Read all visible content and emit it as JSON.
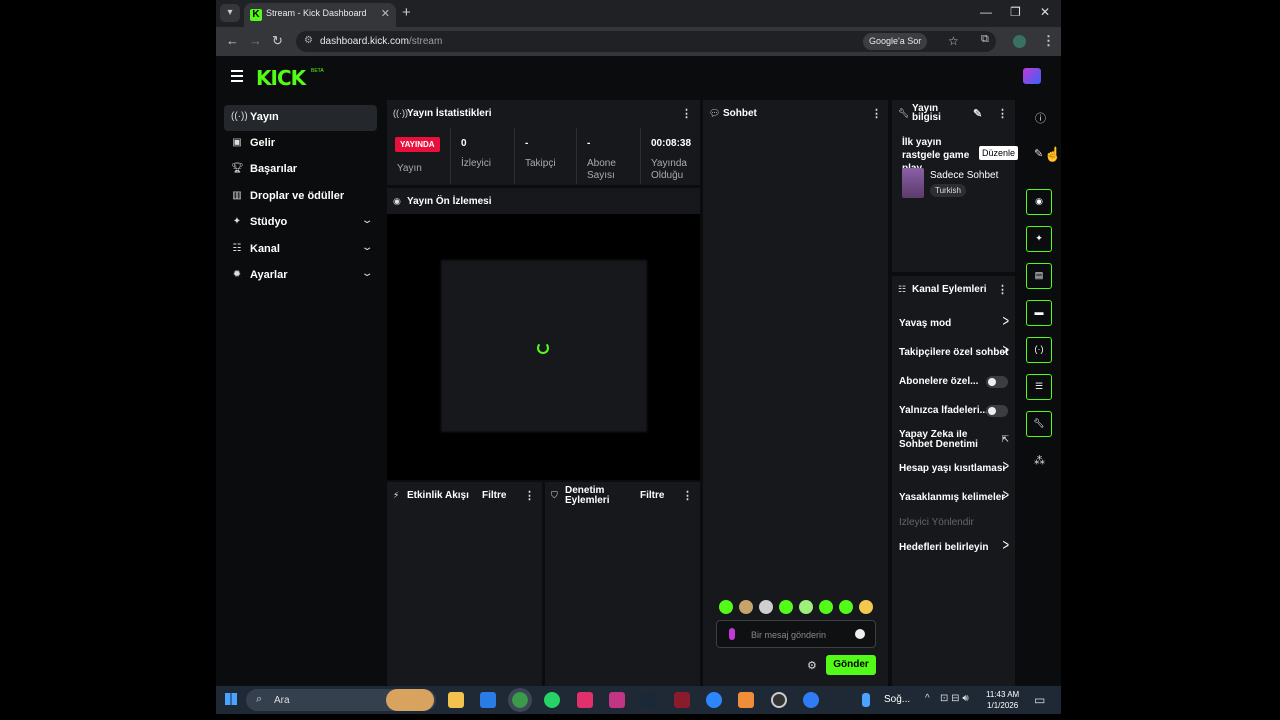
{
  "browser": {
    "tab_title": "Stream - Kick Dashboard",
    "url_host": "dashboard.kick.com",
    "url_path": "/stream",
    "google_search_chip": "Google'a Sor"
  },
  "header": {
    "logo": "KICK",
    "beta": "BETA"
  },
  "sidebar": {
    "items": [
      {
        "label": "Yayın",
        "icon": "broadcast-icon"
      },
      {
        "label": "Gelir",
        "icon": "revenue-icon"
      },
      {
        "label": "Başarılar",
        "icon": "trophy-icon"
      },
      {
        "label": "Droplar ve ödüller",
        "icon": "drops-icon"
      },
      {
        "label": "Stüdyo",
        "icon": "studio-icon"
      },
      {
        "label": "Kanal",
        "icon": "channel-icon"
      },
      {
        "label": "Ayarlar",
        "icon": "settings-icon"
      }
    ]
  },
  "stats": {
    "title": "Yayın İstatistikleri",
    "live_badge": "YAYINDA",
    "stream_label": "Yayın",
    "viewers": {
      "value": "0",
      "label": "İzleyici"
    },
    "followers": {
      "value": "-",
      "label": "Takipçi"
    },
    "subscribers": {
      "value": "-",
      "label": "Abone Sayısı"
    },
    "duration": {
      "value": "00:08:38",
      "label": "Yayında Olduğu"
    }
  },
  "preview": {
    "title": "Yayın Ön İzlemesi"
  },
  "activity": {
    "title": "Etkinlik Akışı",
    "filter": "Filtre"
  },
  "moderation": {
    "title": "Denetim Eylemleri",
    "filter": "Filtre"
  },
  "chat": {
    "title": "Sohbet",
    "placeholder": "Bir mesaj gönderin",
    "send": "Gönder"
  },
  "stream_info": {
    "title": "Yayın bilgisi",
    "stream_title": "İlk yayın rastgele game play",
    "category": "Sadece Sohbet",
    "language_tag": "Turkish",
    "edit_tooltip": "Düzenle"
  },
  "channel_actions": {
    "title": "Kanal Eylemleri",
    "items": [
      {
        "label": "Yavaş mod",
        "kind": "chevron"
      },
      {
        "label": "Takipçilere özel sohbet",
        "kind": "chevron"
      },
      {
        "label": "Abonelere özel...",
        "kind": "toggle"
      },
      {
        "label": "Yalnızca İfadeleri...",
        "kind": "toggle"
      },
      {
        "label": "Yapay Zeka ile Sohbet Denetimi",
        "kind": "external"
      },
      {
        "label": "Hesap yaşı kısıtlaması",
        "kind": "chevron"
      },
      {
        "label": "Yasaklanmış kelimeler",
        "kind": "chevron"
      },
      {
        "label": "İzleyici Yönlendir",
        "kind": "disabled"
      },
      {
        "label": "Hedefleri belirleyin",
        "kind": "chevron"
      }
    ]
  },
  "taskbar": {
    "search": "Ara",
    "weather": "Soğ...",
    "time": "11:43 AM",
    "date": "1/1/2026"
  }
}
